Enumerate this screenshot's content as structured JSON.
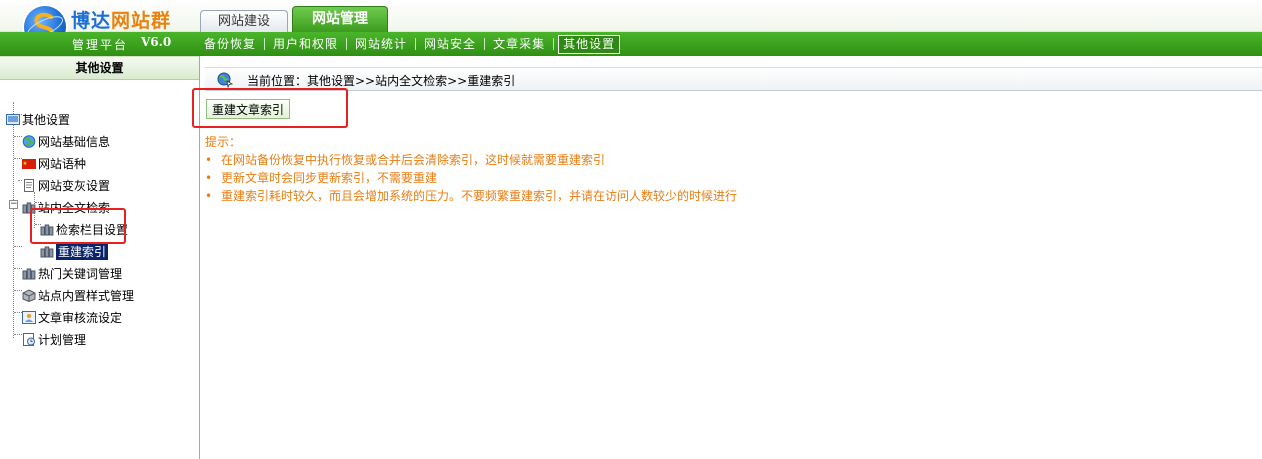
{
  "app": {
    "logo_part1": "博达",
    "logo_part2": "网站群",
    "platform_label": "管理平台",
    "version": "V6.0"
  },
  "top_tabs": [
    {
      "label": "网站建设",
      "active": false
    },
    {
      "label": "网站管理",
      "active": true
    }
  ],
  "nav_menu": [
    {
      "label": "备份恢复",
      "active": false
    },
    {
      "label": "用户和权限",
      "active": false
    },
    {
      "label": "网站统计",
      "active": false
    },
    {
      "label": "网站安全",
      "active": false
    },
    {
      "label": "文章采集",
      "active": false
    },
    {
      "label": "其他设置",
      "active": true
    }
  ],
  "sidebar": {
    "title": "其他设置",
    "tree": [
      {
        "label": "其他设置",
        "icon": "settings-panel-icon",
        "level": 0
      },
      {
        "label": "网站基础信息",
        "icon": "globe-icon",
        "level": 1
      },
      {
        "label": "网站语种",
        "icon": "flag-icon",
        "level": 1
      },
      {
        "label": "网站变灰设置",
        "icon": "document-icon",
        "level": 1
      },
      {
        "label": "站内全文检索",
        "icon": "database-icon",
        "level": 1,
        "expanded": true
      },
      {
        "label": "检索栏目设置",
        "icon": "database-icon",
        "level": 2
      },
      {
        "label": "重建索引",
        "icon": "database-icon",
        "level": 2,
        "selected": true
      },
      {
        "label": "热门关键词管理",
        "icon": "database-icon",
        "level": 1
      },
      {
        "label": "站点内置样式管理",
        "icon": "cube-icon",
        "level": 1
      },
      {
        "label": "文章审核流设定",
        "icon": "review-icon",
        "level": 1
      },
      {
        "label": "计划管理",
        "icon": "schedule-icon",
        "level": 1
      }
    ]
  },
  "main": {
    "breadcrumb": "当前位置：其他设置>>站内全文检索>>重建索引",
    "rebuild_button_label": "重建文章索引",
    "tips_title": "提示：",
    "tips": [
      "在网站备份恢复中执行恢复或合并后会清除索引，这时候就需要重建索引",
      "更新文章时会同步更新索引，不需要重建",
      "重建索引耗时较久，而且会增加系统的压力。不要频繁重建索引，并请在访问人数较少的时候进行"
    ],
    "bullet": "•"
  },
  "colors": {
    "accent_green": "#3a9a1c",
    "tip_orange": "#e67e14",
    "highlight_red": "#e82020",
    "selected_bg": "#0a246a"
  }
}
